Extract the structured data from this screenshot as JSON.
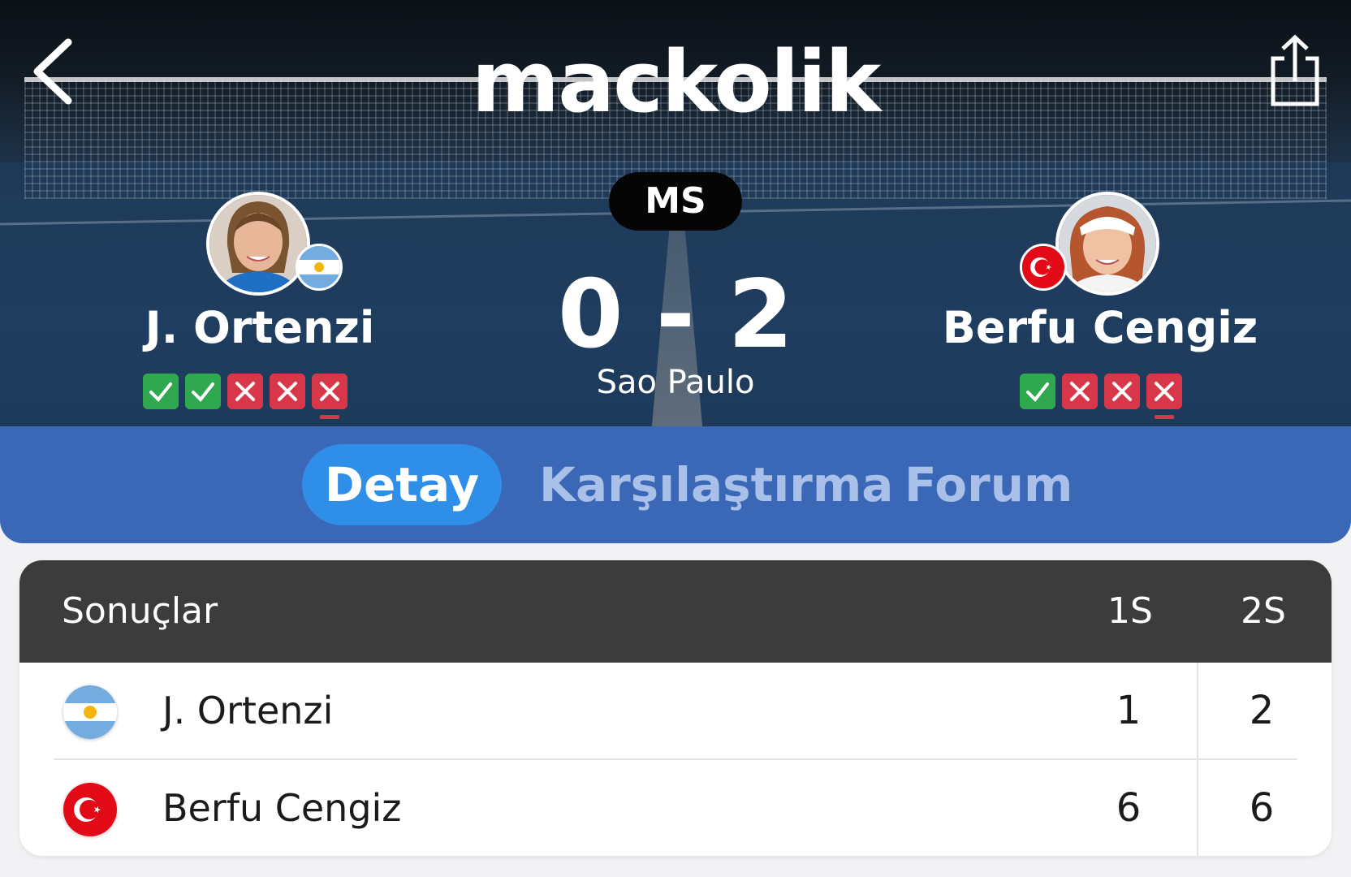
{
  "header": {
    "brand": "mackolik",
    "status": "MS",
    "score": "0 - 2",
    "venue": "Sao Paulo"
  },
  "home": {
    "name": "J. Ortenzi",
    "flag": "argentina-flag-icon",
    "form": [
      "W",
      "W",
      "L",
      "L",
      "L"
    ]
  },
  "away": {
    "name": "Berfu Cengiz",
    "flag": "turkey-flag-icon",
    "form": [
      "W",
      "L",
      "L",
      "L"
    ]
  },
  "tabs": [
    {
      "label": "Detay",
      "active": true
    },
    {
      "label": "Karşılaştırma",
      "active": false
    },
    {
      "label": "Forum",
      "active": false
    }
  ],
  "results": {
    "title": "Sonuçlar",
    "columns": [
      "1S",
      "2S"
    ],
    "rows": [
      {
        "name": "J. Ortenzi",
        "sets": [
          "1",
          "2"
        ]
      },
      {
        "name": "Berfu Cengiz",
        "sets": [
          "6",
          "6"
        ]
      }
    ]
  },
  "colors": {
    "win": "#2fa84f",
    "loss": "#d8374a",
    "tab_bar": "#3b67b7",
    "tab_active": "#2f8fe8"
  }
}
